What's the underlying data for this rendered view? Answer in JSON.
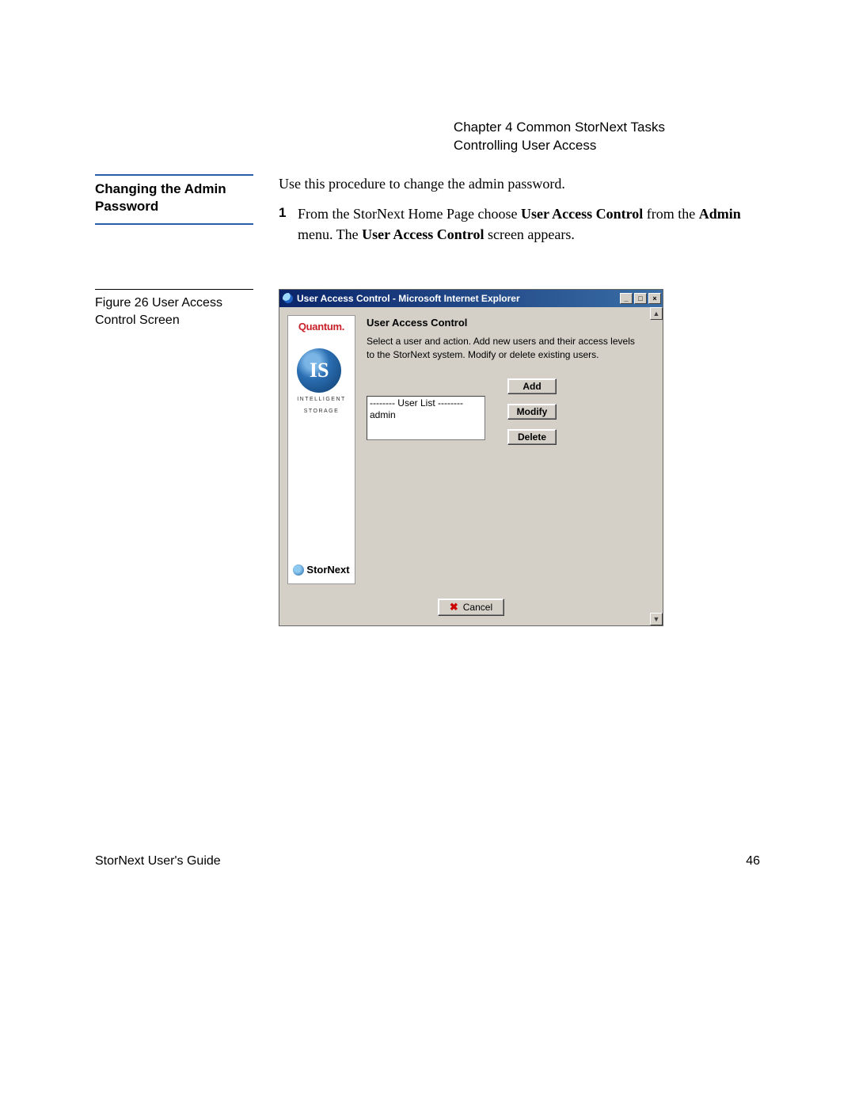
{
  "header": {
    "chapter": "Chapter 4  Common StorNext Tasks",
    "section": "Controlling User Access"
  },
  "left": {
    "heading": "Changing the Admin Password",
    "figure_caption": "Figure 26  User Access Control Screen"
  },
  "body": {
    "intro": "Use this procedure to change the admin password.",
    "step_num": "1",
    "step_pre": "From the StorNext Home Page choose ",
    "step_b1": "User Access Control",
    "step_mid": " from the ",
    "step_b2": "Admin",
    "step_mid2": " menu. The ",
    "step_b3": "User Access Control",
    "step_post": " screen appears."
  },
  "win": {
    "title": "User Access Control - Microsoft Internet Explorer",
    "min": "_",
    "max": "□",
    "close": "×",
    "scroll_up": "▲",
    "scroll_dn": "▼",
    "sidebar": {
      "quantum": "Quantum.",
      "is": "IS",
      "is_sub1": "INTELLIGENT",
      "is_sub2": "STORAGE",
      "stornext": "StorNext"
    },
    "main": {
      "heading": "User Access Control",
      "desc": "Select a user and action. Add new users and their access levels to the StorNext system. Modify or delete existing users.",
      "list_header": "-------- User List --------",
      "list_item": "admin",
      "add": "Add",
      "modify": "Modify",
      "delete": "Delete",
      "cancel": "Cancel"
    }
  },
  "footer": {
    "left": "StorNext User's Guide",
    "right": "46"
  }
}
